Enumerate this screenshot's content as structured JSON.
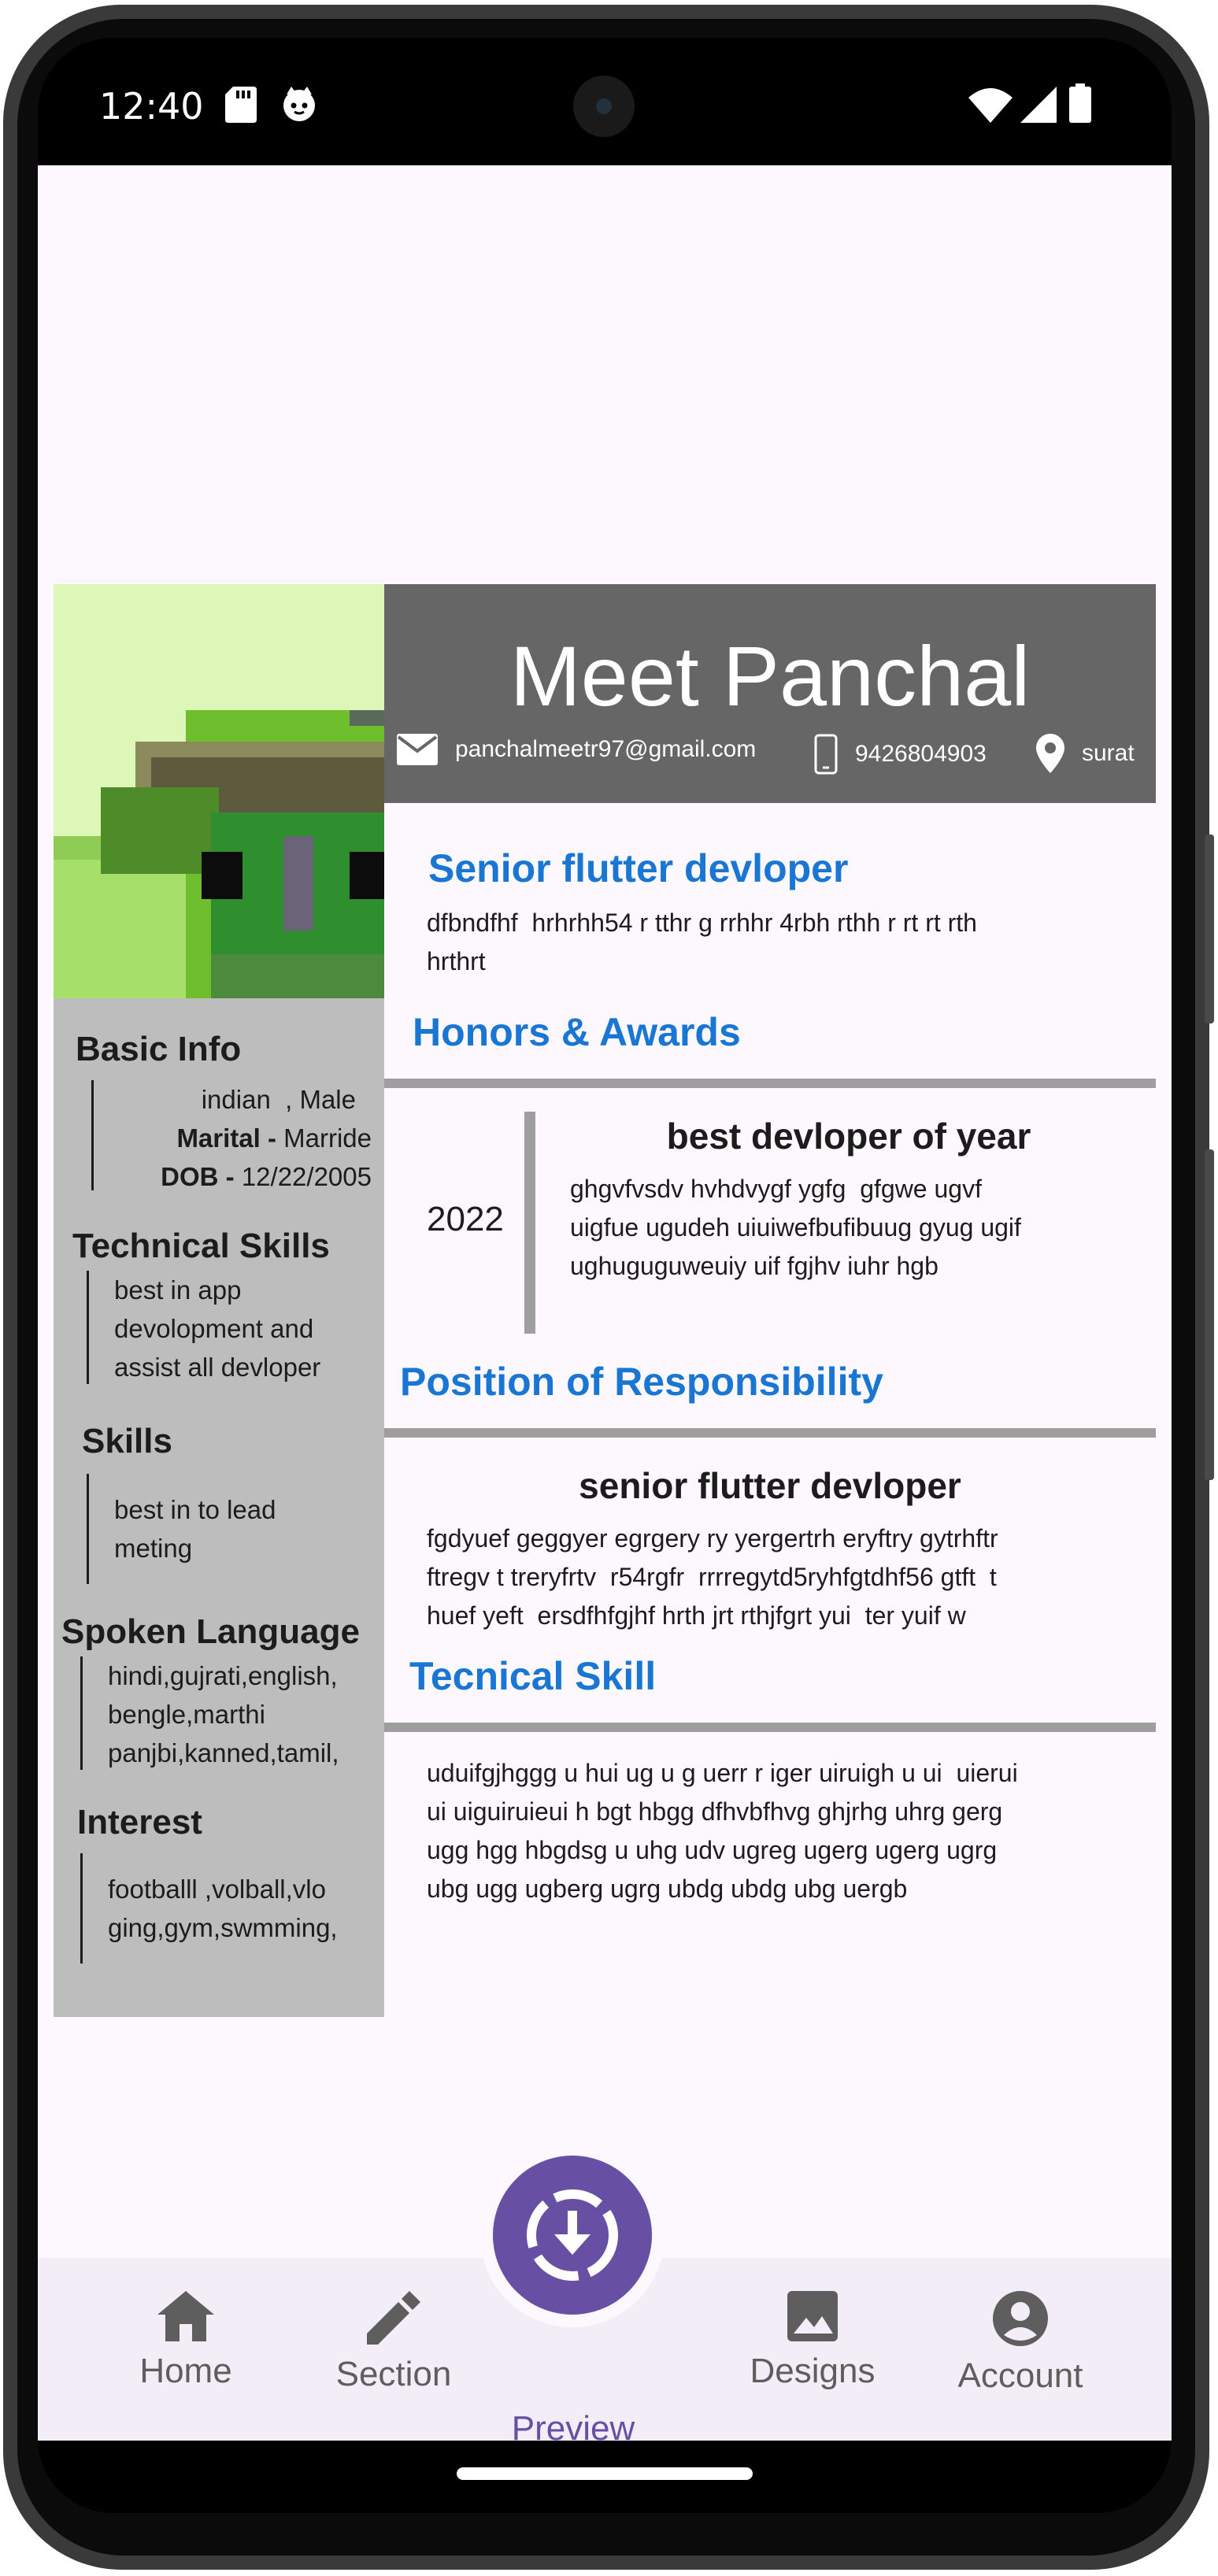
{
  "status_bar": {
    "time": "12:40"
  },
  "resume": {
    "name": "Meet Panchal",
    "contact": {
      "email": "panchalmeetr97@gmail.com",
      "phone": "9426804903",
      "location": "surat"
    },
    "left": {
      "basic_info": {
        "title": "Basic Info",
        "nationality_gender": "indian  , Male",
        "marital_label": "Marital - ",
        "marital_value": "Marride",
        "dob_label": "DOB - ",
        "dob_value": "12/22/2005"
      },
      "technical_skills": {
        "title": "Technical Skills",
        "lines": [
          "best in app",
          "devolopment and",
          "assist all devloper"
        ]
      },
      "skills": {
        "title": "Skills",
        "lines": [
          "best in to lead",
          "meting"
        ]
      },
      "spoken_language": {
        "title": "Spoken Language",
        "lines": [
          "hindi,gujrati,english,",
          "bengle,marthi",
          "panjbi,kanned,tamil,"
        ]
      },
      "interest": {
        "title": "Interest",
        "lines": [
          "footballl ,volball,vlo",
          "ging,gym,swmming,"
        ]
      }
    },
    "right": {
      "objective": {
        "title": "Senior flutter devloper",
        "lines": [
          "dfbndfhf  hrhrhh54 r tthr g rrhhr 4rbh rthh r rt rt rth",
          "hrthrt"
        ]
      },
      "honors": {
        "title": "Honors & Awards",
        "year": "2022",
        "award_title": "best devloper of year",
        "lines": [
          "ghgvfvsdv hvhdvygf ygfg  gfgwe ugvf",
          "uigfue ugudeh uiuiwefbufibuug gyug ugif",
          "ughuguguweuiy uif fgjhv iuhr hgb"
        ]
      },
      "position": {
        "title": "Position of Responsibility",
        "role": "senior flutter devloper",
        "lines": [
          "fgdyuef geggyer egrgery ry yergertrh eryftry gytrhftr",
          "ftregv t treryfrtv  r54rgfr  rrrregytd5ryhfgtdhf56 gtft  t",
          "huef yeft  ersdfhfgjhf hrth jrt rthjfgrt yui  ter yuif w"
        ]
      },
      "technical": {
        "title": "Tecnical Skill",
        "lines": [
          "uduifgjhggg u hui ug u g uerr r iger uiruigh u ui  uierui",
          "ui uiguiruieui h bgt hbgg dfhvbfhvg ghjrhg uhrg gerg",
          "ugg hgg hbgdsg u uhg udv ugreg ugerg ugerg ugrg",
          "ubg ugg ugberg ugrg ubdg ubdg ubg uergb"
        ]
      }
    }
  },
  "bottom_nav": {
    "items": [
      {
        "label": "Home",
        "icon": "home-icon"
      },
      {
        "label": "Section",
        "icon": "pencil-icon"
      },
      {
        "label": "Preview",
        "icon": "download-icon"
      },
      {
        "label": "Designs",
        "icon": "image-icon"
      },
      {
        "label": "Account",
        "icon": "account-icon"
      }
    ]
  },
  "colors": {
    "accent_blue": "#1976d2",
    "header_gray": "#666666",
    "sidebar_gray": "#bdbdbd",
    "fab_purple": "#6750a4"
  }
}
